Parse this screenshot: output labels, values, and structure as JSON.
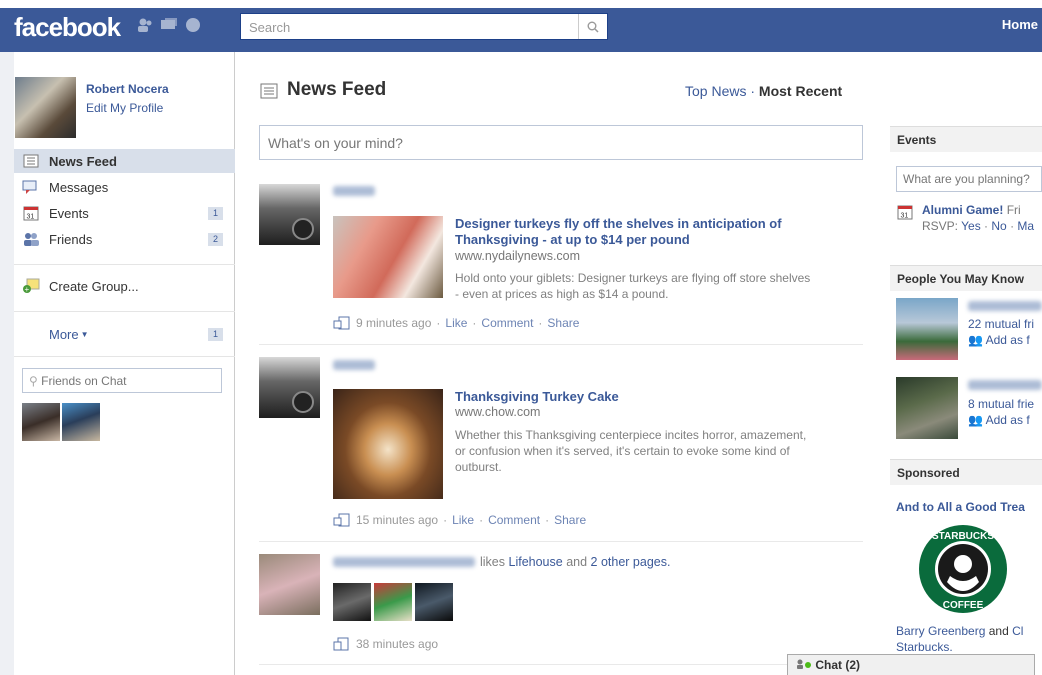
{
  "header": {
    "logo": "facebook",
    "search_placeholder": "Search",
    "home": "Home"
  },
  "profile": {
    "name": "Robert Nocera",
    "edit": "Edit My Profile"
  },
  "nav": [
    {
      "label": "News Feed",
      "icon": "newsfeed-icon",
      "count": ""
    },
    {
      "label": "Messages",
      "icon": "messages-icon",
      "count": ""
    },
    {
      "label": "Events",
      "icon": "calendar-icon",
      "count": "1"
    },
    {
      "label": "Friends",
      "icon": "friends-icon",
      "count": "2"
    }
  ],
  "create_group": "Create Group...",
  "more": {
    "label": "More",
    "count": "1"
  },
  "chat_search_placeholder": "Friends on Chat",
  "main": {
    "title": "News Feed",
    "top_news": "Top News",
    "separator": "·",
    "most_recent": "Most Recent",
    "status_placeholder": "What's on your mind?"
  },
  "stories": [
    {
      "link_title": "Designer turkeys fly off the shelves in anticipation of Thanksgiving - at up to $14 per pound",
      "url": "www.nydailynews.com",
      "desc": "Hold onto your giblets: Designer turkeys are flying off store shelves - even at prices as high as $14 a pound.",
      "time": "9 minutes ago",
      "like": "Like",
      "comment": "Comment",
      "share": "Share"
    },
    {
      "link_title": "Thanksgiving Turkey Cake",
      "url": "www.chow.com",
      "desc": "Whether this Thanksgiving centerpiece incites horror, amazement, or confusion when it's served, it's certain to evoke some kind of outburst.",
      "time": "15 minutes ago",
      "like": "Like",
      "comment": "Comment",
      "share": "Share"
    },
    {
      "likes_text": "likes",
      "page1": "Lifehouse",
      "and_text": "and",
      "page2": "2 other pages.",
      "time": "38 minutes ago"
    }
  ],
  "right": {
    "events_header": "Events",
    "events_placeholder": "What are you planning?",
    "event_name": "Alumni Game!",
    "event_day": "Fri",
    "rsvp": "RSVP:",
    "yes": "Yes",
    "no": "No",
    "maybe": "Ma",
    "pymk_header": "People You May Know",
    "person1_mutual": "22 mutual fri",
    "person2_mutual": "8 mutual frie",
    "add_friend": "Add as f",
    "sponsored_header": "Sponsored",
    "ad_title": "And to All a Good Trea",
    "ad_brand_top": "STARBUCKS",
    "ad_brand_bottom": "COFFEE",
    "ad_social_name": "Barry Greenberg",
    "ad_social_and": "and",
    "ad_social_more": "Cl",
    "ad_social_page": "Starbucks."
  },
  "chatbar": {
    "label": "Chat (2)"
  },
  "colors": {
    "brand": "#3b5998",
    "link": "#3b5998",
    "nav_selected": "#d8dfea"
  }
}
